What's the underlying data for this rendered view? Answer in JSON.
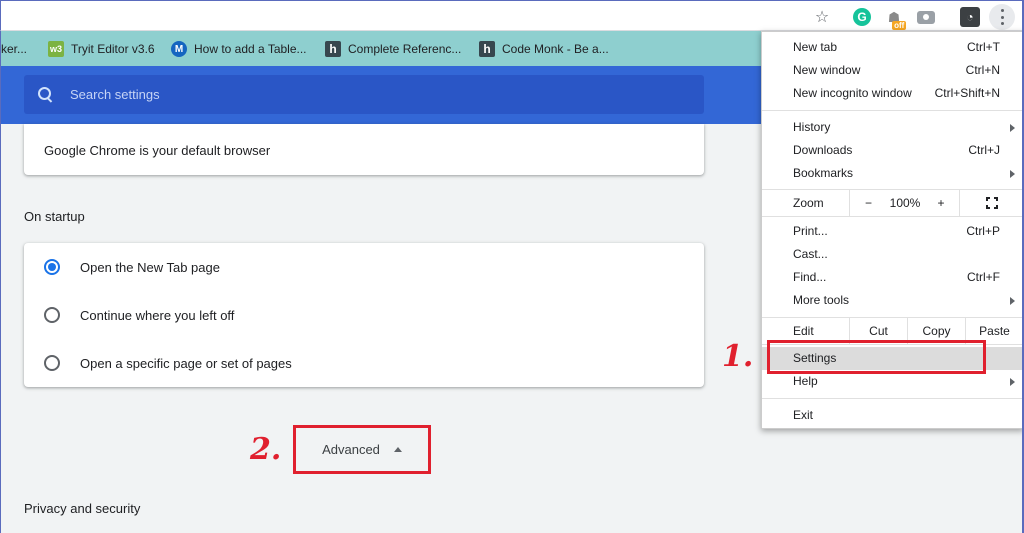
{
  "bookmarks": [
    {
      "label": "ker...",
      "icon": "page-fragment"
    },
    {
      "label": "Tryit Editor v3.6",
      "icon": "w3schools-icon"
    },
    {
      "label": "How to add a Table...",
      "icon": "m-icon"
    },
    {
      "label": "Complete Referenc...",
      "icon": "h-icon"
    },
    {
      "label": "Code Monk - Be a...",
      "icon": "h-icon"
    }
  ],
  "toolbar": {
    "grammarly": "G",
    "off_badge": "off"
  },
  "search": {
    "placeholder": "Search settings"
  },
  "default_browser": {
    "text": "Google Chrome is your default browser"
  },
  "startup": {
    "title": "On startup",
    "options": [
      {
        "label": "Open the New Tab page",
        "checked": true
      },
      {
        "label": "Continue where you left off",
        "checked": false
      },
      {
        "label": "Open a specific page or set of pages",
        "checked": false
      }
    ]
  },
  "advanced": {
    "label": "Advanced"
  },
  "privacy": {
    "title": "Privacy and security"
  },
  "annotations": {
    "one": "1.",
    "two": "2."
  },
  "menu": {
    "new_tab": {
      "label": "New tab",
      "shortcut": "Ctrl+T"
    },
    "new_window": {
      "label": "New window",
      "shortcut": "Ctrl+N"
    },
    "new_incognito": {
      "label": "New incognito window",
      "shortcut": "Ctrl+Shift+N"
    },
    "history": {
      "label": "History"
    },
    "downloads": {
      "label": "Downloads",
      "shortcut": "Ctrl+J"
    },
    "bookmarks": {
      "label": "Bookmarks"
    },
    "zoom": {
      "label": "Zoom",
      "minus": "−",
      "value": "100%",
      "plus": "+"
    },
    "print": {
      "label": "Print...",
      "shortcut": "Ctrl+P"
    },
    "cast": {
      "label": "Cast..."
    },
    "find": {
      "label": "Find...",
      "shortcut": "Ctrl+F"
    },
    "more_tools": {
      "label": "More tools"
    },
    "edit": {
      "label": "Edit",
      "cut": "Cut",
      "copy": "Copy",
      "paste": "Paste"
    },
    "settings": {
      "label": "Settings"
    },
    "help": {
      "label": "Help"
    },
    "exit": {
      "label": "Exit"
    }
  },
  "colors": {
    "accent": "#3367d6",
    "annotation_red": "#e0202e",
    "radio_blue": "#1a73e8"
  }
}
